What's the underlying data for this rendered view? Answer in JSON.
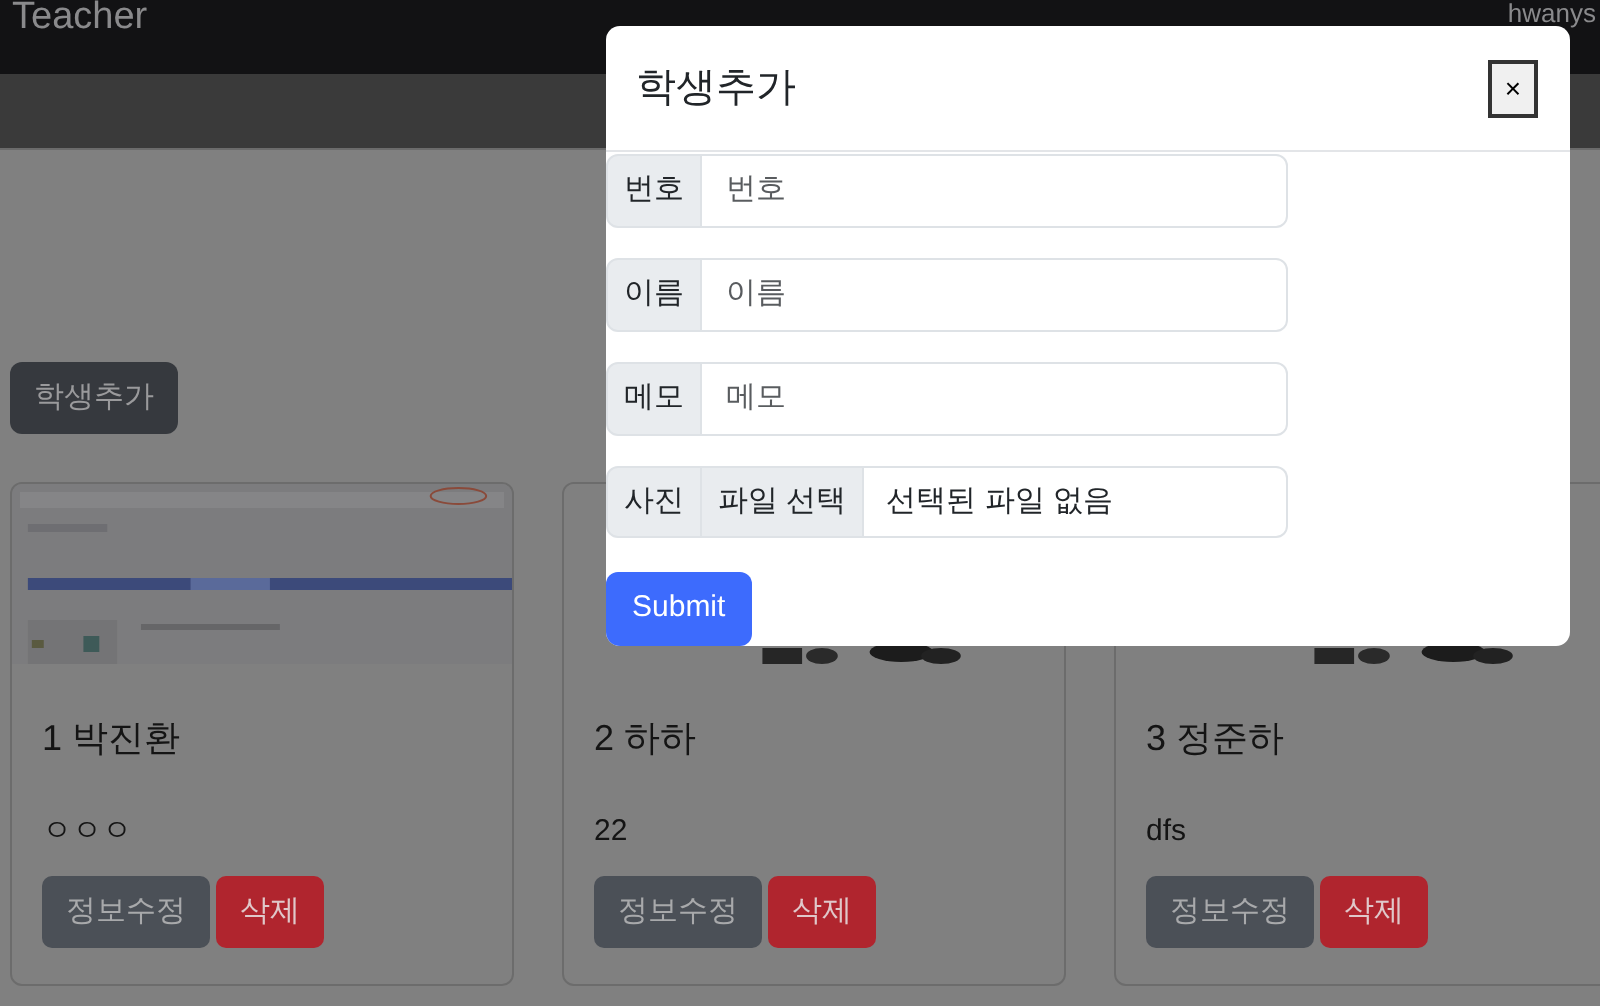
{
  "navbar": {
    "brand": "Teacher",
    "user": "hwanys"
  },
  "add_button": "학생추가",
  "cards": [
    {
      "title": "1 박진환",
      "memo": "ㅇㅇㅇ",
      "picture": {
        "kind": "picture"
      },
      "buttons": [
        {
          "kind": "edit",
          "label": "정보수정"
        },
        {
          "kind": "delete",
          "label": "삭제"
        }
      ]
    },
    {
      "title": "2 하하",
      "memo": "22",
      "picture": {
        "kind": "picture"
      },
      "buttons": [
        {
          "kind": "edit",
          "label": "정보수정"
        },
        {
          "kind": "delete",
          "label": "삭제"
        }
      ]
    },
    {
      "title": "3 정준하",
      "memo": "dfs",
      "picture": {
        "kind": "picture"
      },
      "buttons": [
        {
          "kind": "edit",
          "label": "정보수정"
        },
        {
          "kind": "delete",
          "label": "삭제"
        }
      ]
    }
  ],
  "modal": {
    "title": "학생추가",
    "close": "×",
    "fields": [
      {
        "kind": "text",
        "label": "번호",
        "placeholder": "번호"
      },
      {
        "kind": "text",
        "label": "이름",
        "placeholder": "이름"
      },
      {
        "kind": "text",
        "label": "메모",
        "placeholder": "메모"
      },
      {
        "kind": "file",
        "label": "사진",
        "button": "파일 선택",
        "status": "선택된 파일 없음"
      }
    ],
    "submit": "Submit"
  }
}
